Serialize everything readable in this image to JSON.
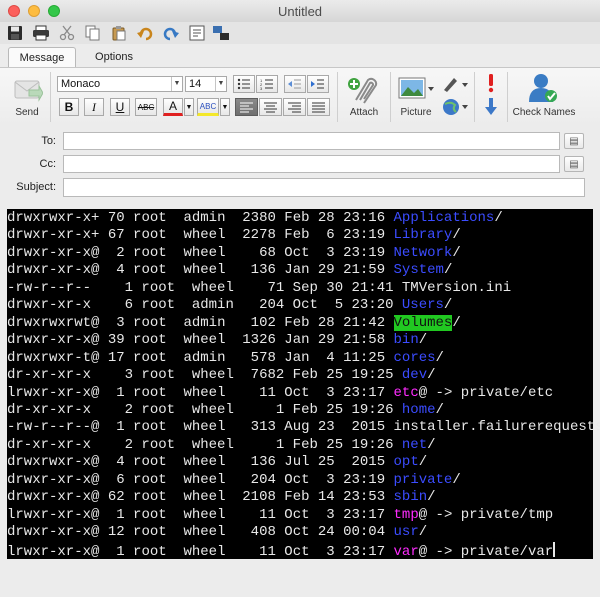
{
  "window": {
    "title": "Untitled"
  },
  "tabs": [
    {
      "label": "Message",
      "active": true
    },
    {
      "label": "Options",
      "active": false
    }
  ],
  "ribbon": {
    "send_label": "Send",
    "font_name": "Monaco",
    "font_size": "14",
    "bold": "B",
    "italic": "I",
    "underline": "U",
    "strike": "ABC",
    "font_color": "A",
    "highlight": "ABC",
    "attach_label": "Attach",
    "picture_label": "Picture",
    "check_names_label": "Check Names"
  },
  "fields": {
    "to_label": "To:",
    "cc_label": "Cc:",
    "subject_label": "Subject:",
    "to_value": "",
    "cc_value": "",
    "subject_value": ""
  },
  "terminal": {
    "colors": {
      "background": "#000000",
      "text": "#e8e8e8",
      "dir": "#3b4cff",
      "link": "#ff2cff",
      "highlight": "#21c821"
    },
    "rows": [
      {
        "perms": "drwxrwxr-x+",
        "links": "70",
        "owner": "root",
        "group": "admin",
        "size": "2380",
        "date": "Feb 28 23:16",
        "name": "Applications",
        "kind": "dir",
        "suffix": "/",
        "target": ""
      },
      {
        "perms": "drwxr-xr-x+",
        "links": "67",
        "owner": "root",
        "group": "wheel",
        "size": "2278",
        "date": "Feb  6 23:19",
        "name": "Library",
        "kind": "dir",
        "suffix": "/",
        "target": ""
      },
      {
        "perms": "drwxr-xr-x@",
        "links": " 2",
        "owner": "root",
        "group": "wheel",
        "size": "  68",
        "date": "Oct  3 23:19",
        "name": "Network",
        "kind": "dir",
        "suffix": "/",
        "target": ""
      },
      {
        "perms": "drwxr-xr-x@",
        "links": " 4",
        "owner": "root",
        "group": "wheel",
        "size": " 136",
        "date": "Jan 29 21:59",
        "name": "System",
        "kind": "dir",
        "suffix": "/",
        "target": ""
      },
      {
        "perms": "-rw-r--r--",
        "links": "  1",
        "owner": "root",
        "group": "wheel",
        "size": "  71",
        "date": "Sep 30 21:41",
        "name": "TMVersion.ini",
        "kind": "file",
        "suffix": "",
        "target": ""
      },
      {
        "perms": "drwxr-xr-x",
        "links": "  6",
        "owner": "root",
        "group": "admin",
        "size": " 204",
        "date": "Oct  5 23:20",
        "name": "Users",
        "kind": "dir",
        "suffix": "/",
        "target": ""
      },
      {
        "perms": "drwxrwxrwt@",
        "links": " 3",
        "owner": "root",
        "group": "admin",
        "size": " 102",
        "date": "Feb 28 21:42",
        "name": "Volumes",
        "kind": "hl",
        "suffix": "/",
        "target": ""
      },
      {
        "perms": "drwxr-xr-x@",
        "links": "39",
        "owner": "root",
        "group": "wheel",
        "size": "1326",
        "date": "Jan 29 21:58",
        "name": "bin",
        "kind": "dir",
        "suffix": "/",
        "target": ""
      },
      {
        "perms": "drwxrwxr-t@",
        "links": "17",
        "owner": "root",
        "group": "admin",
        "size": " 578",
        "date": "Jan  4 11:25",
        "name": "cores",
        "kind": "dir",
        "suffix": "/",
        "target": ""
      },
      {
        "perms": "dr-xr-xr-x",
        "links": "  3",
        "owner": "root",
        "group": "wheel",
        "size": "7682",
        "date": "Feb 25 19:25",
        "name": "dev",
        "kind": "dir",
        "suffix": "/",
        "target": ""
      },
      {
        "perms": "lrwxr-xr-x@",
        "links": " 1",
        "owner": "root",
        "group": "wheel",
        "size": "  11",
        "date": "Oct  3 23:17",
        "name": "etc",
        "kind": "link",
        "suffix": "@",
        "target": " -> private/etc"
      },
      {
        "perms": "dr-xr-xr-x",
        "links": "  2",
        "owner": "root",
        "group": "wheel",
        "size": "   1",
        "date": "Feb 25 19:26",
        "name": "home",
        "kind": "dir",
        "suffix": "/",
        "target": ""
      },
      {
        "perms": "-rw-r--r--@",
        "links": " 1",
        "owner": "root",
        "group": "wheel",
        "size": " 313",
        "date": "Aug 23  2015",
        "name": "installer.failurerequests",
        "kind": "file",
        "suffix": "",
        "target": ""
      },
      {
        "perms": "dr-xr-xr-x",
        "links": "  2",
        "owner": "root",
        "group": "wheel",
        "size": "   1",
        "date": "Feb 25 19:26",
        "name": "net",
        "kind": "dir",
        "suffix": "/",
        "target": ""
      },
      {
        "perms": "drwxrwxr-x@",
        "links": " 4",
        "owner": "root",
        "group": "wheel",
        "size": " 136",
        "date": "Jul 25  2015",
        "name": "opt",
        "kind": "dir",
        "suffix": "/",
        "target": ""
      },
      {
        "perms": "drwxr-xr-x@",
        "links": " 6",
        "owner": "root",
        "group": "wheel",
        "size": " 204",
        "date": "Oct  3 23:19",
        "name": "private",
        "kind": "dir",
        "suffix": "/",
        "target": ""
      },
      {
        "perms": "drwxr-xr-x@",
        "links": "62",
        "owner": "root",
        "group": "wheel",
        "size": "2108",
        "date": "Feb 14 23:53",
        "name": "sbin",
        "kind": "dir",
        "suffix": "/",
        "target": ""
      },
      {
        "perms": "lrwxr-xr-x@",
        "links": " 1",
        "owner": "root",
        "group": "wheel",
        "size": "  11",
        "date": "Oct  3 23:17",
        "name": "tmp",
        "kind": "link",
        "suffix": "@",
        "target": " -> private/tmp"
      },
      {
        "perms": "drwxr-xr-x@",
        "links": "12",
        "owner": "root",
        "group": "wheel",
        "size": " 408",
        "date": "Oct 24 00:04",
        "name": "usr",
        "kind": "dir",
        "suffix": "/",
        "target": ""
      },
      {
        "perms": "lrwxr-xr-x@",
        "links": " 1",
        "owner": "root",
        "group": "wheel",
        "size": "  11",
        "date": "Oct  3 23:17",
        "name": "var",
        "kind": "link",
        "suffix": "@",
        "target": " -> private/var"
      }
    ]
  }
}
